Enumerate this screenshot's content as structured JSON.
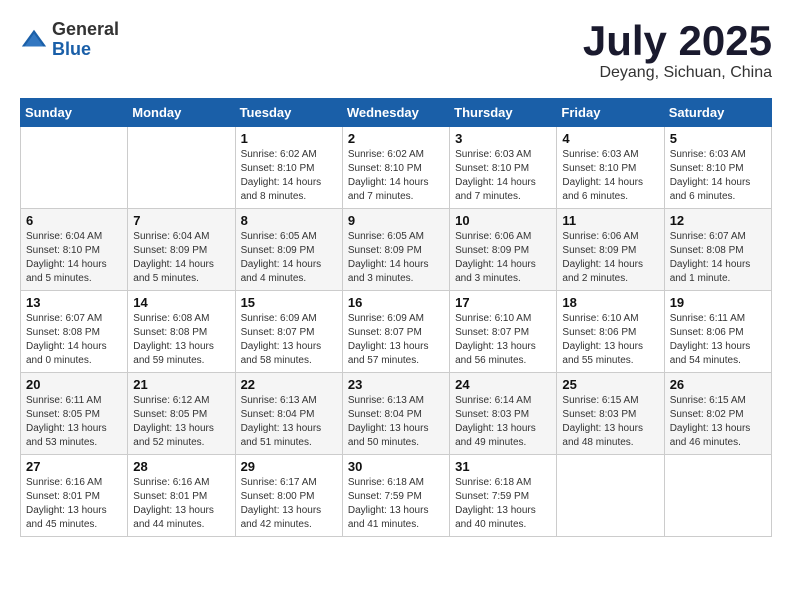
{
  "header": {
    "logo_general": "General",
    "logo_blue": "Blue",
    "month_title": "July 2025",
    "location": "Deyang, Sichuan, China"
  },
  "weekdays": [
    "Sunday",
    "Monday",
    "Tuesday",
    "Wednesday",
    "Thursday",
    "Friday",
    "Saturday"
  ],
  "weeks": [
    [
      {
        "day": "",
        "sunrise": "",
        "sunset": "",
        "daylight": ""
      },
      {
        "day": "",
        "sunrise": "",
        "sunset": "",
        "daylight": ""
      },
      {
        "day": "1",
        "sunrise": "Sunrise: 6:02 AM",
        "sunset": "Sunset: 8:10 PM",
        "daylight": "Daylight: 14 hours and 8 minutes."
      },
      {
        "day": "2",
        "sunrise": "Sunrise: 6:02 AM",
        "sunset": "Sunset: 8:10 PM",
        "daylight": "Daylight: 14 hours and 7 minutes."
      },
      {
        "day": "3",
        "sunrise": "Sunrise: 6:03 AM",
        "sunset": "Sunset: 8:10 PM",
        "daylight": "Daylight: 14 hours and 7 minutes."
      },
      {
        "day": "4",
        "sunrise": "Sunrise: 6:03 AM",
        "sunset": "Sunset: 8:10 PM",
        "daylight": "Daylight: 14 hours and 6 minutes."
      },
      {
        "day": "5",
        "sunrise": "Sunrise: 6:03 AM",
        "sunset": "Sunset: 8:10 PM",
        "daylight": "Daylight: 14 hours and 6 minutes."
      }
    ],
    [
      {
        "day": "6",
        "sunrise": "Sunrise: 6:04 AM",
        "sunset": "Sunset: 8:10 PM",
        "daylight": "Daylight: 14 hours and 5 minutes."
      },
      {
        "day": "7",
        "sunrise": "Sunrise: 6:04 AM",
        "sunset": "Sunset: 8:09 PM",
        "daylight": "Daylight: 14 hours and 5 minutes."
      },
      {
        "day": "8",
        "sunrise": "Sunrise: 6:05 AM",
        "sunset": "Sunset: 8:09 PM",
        "daylight": "Daylight: 14 hours and 4 minutes."
      },
      {
        "day": "9",
        "sunrise": "Sunrise: 6:05 AM",
        "sunset": "Sunset: 8:09 PM",
        "daylight": "Daylight: 14 hours and 3 minutes."
      },
      {
        "day": "10",
        "sunrise": "Sunrise: 6:06 AM",
        "sunset": "Sunset: 8:09 PM",
        "daylight": "Daylight: 14 hours and 3 minutes."
      },
      {
        "day": "11",
        "sunrise": "Sunrise: 6:06 AM",
        "sunset": "Sunset: 8:09 PM",
        "daylight": "Daylight: 14 hours and 2 minutes."
      },
      {
        "day": "12",
        "sunrise": "Sunrise: 6:07 AM",
        "sunset": "Sunset: 8:08 PM",
        "daylight": "Daylight: 14 hours and 1 minute."
      }
    ],
    [
      {
        "day": "13",
        "sunrise": "Sunrise: 6:07 AM",
        "sunset": "Sunset: 8:08 PM",
        "daylight": "Daylight: 14 hours and 0 minutes."
      },
      {
        "day": "14",
        "sunrise": "Sunrise: 6:08 AM",
        "sunset": "Sunset: 8:08 PM",
        "daylight": "Daylight: 13 hours and 59 minutes."
      },
      {
        "day": "15",
        "sunrise": "Sunrise: 6:09 AM",
        "sunset": "Sunset: 8:07 PM",
        "daylight": "Daylight: 13 hours and 58 minutes."
      },
      {
        "day": "16",
        "sunrise": "Sunrise: 6:09 AM",
        "sunset": "Sunset: 8:07 PM",
        "daylight": "Daylight: 13 hours and 57 minutes."
      },
      {
        "day": "17",
        "sunrise": "Sunrise: 6:10 AM",
        "sunset": "Sunset: 8:07 PM",
        "daylight": "Daylight: 13 hours and 56 minutes."
      },
      {
        "day": "18",
        "sunrise": "Sunrise: 6:10 AM",
        "sunset": "Sunset: 8:06 PM",
        "daylight": "Daylight: 13 hours and 55 minutes."
      },
      {
        "day": "19",
        "sunrise": "Sunrise: 6:11 AM",
        "sunset": "Sunset: 8:06 PM",
        "daylight": "Daylight: 13 hours and 54 minutes."
      }
    ],
    [
      {
        "day": "20",
        "sunrise": "Sunrise: 6:11 AM",
        "sunset": "Sunset: 8:05 PM",
        "daylight": "Daylight: 13 hours and 53 minutes."
      },
      {
        "day": "21",
        "sunrise": "Sunrise: 6:12 AM",
        "sunset": "Sunset: 8:05 PM",
        "daylight": "Daylight: 13 hours and 52 minutes."
      },
      {
        "day": "22",
        "sunrise": "Sunrise: 6:13 AM",
        "sunset": "Sunset: 8:04 PM",
        "daylight": "Daylight: 13 hours and 51 minutes."
      },
      {
        "day": "23",
        "sunrise": "Sunrise: 6:13 AM",
        "sunset": "Sunset: 8:04 PM",
        "daylight": "Daylight: 13 hours and 50 minutes."
      },
      {
        "day": "24",
        "sunrise": "Sunrise: 6:14 AM",
        "sunset": "Sunset: 8:03 PM",
        "daylight": "Daylight: 13 hours and 49 minutes."
      },
      {
        "day": "25",
        "sunrise": "Sunrise: 6:15 AM",
        "sunset": "Sunset: 8:03 PM",
        "daylight": "Daylight: 13 hours and 48 minutes."
      },
      {
        "day": "26",
        "sunrise": "Sunrise: 6:15 AM",
        "sunset": "Sunset: 8:02 PM",
        "daylight": "Daylight: 13 hours and 46 minutes."
      }
    ],
    [
      {
        "day": "27",
        "sunrise": "Sunrise: 6:16 AM",
        "sunset": "Sunset: 8:01 PM",
        "daylight": "Daylight: 13 hours and 45 minutes."
      },
      {
        "day": "28",
        "sunrise": "Sunrise: 6:16 AM",
        "sunset": "Sunset: 8:01 PM",
        "daylight": "Daylight: 13 hours and 44 minutes."
      },
      {
        "day": "29",
        "sunrise": "Sunrise: 6:17 AM",
        "sunset": "Sunset: 8:00 PM",
        "daylight": "Daylight: 13 hours and 42 minutes."
      },
      {
        "day": "30",
        "sunrise": "Sunrise: 6:18 AM",
        "sunset": "Sunset: 7:59 PM",
        "daylight": "Daylight: 13 hours and 41 minutes."
      },
      {
        "day": "31",
        "sunrise": "Sunrise: 6:18 AM",
        "sunset": "Sunset: 7:59 PM",
        "daylight": "Daylight: 13 hours and 40 minutes."
      },
      {
        "day": "",
        "sunrise": "",
        "sunset": "",
        "daylight": ""
      },
      {
        "day": "",
        "sunrise": "",
        "sunset": "",
        "daylight": ""
      }
    ]
  ]
}
